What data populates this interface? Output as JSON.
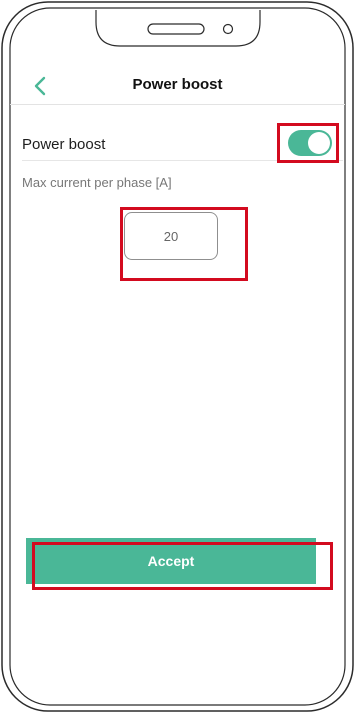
{
  "header": {
    "title": "Power boost",
    "back_icon": "chevron-left-icon"
  },
  "power_boost": {
    "label": "Power boost",
    "enabled": true
  },
  "max_current": {
    "label": "Max current per phase [A]",
    "value": "20"
  },
  "actions": {
    "accept_label": "Accept"
  },
  "colors": {
    "accent": "#4ab797",
    "highlight": "#d30a1f"
  }
}
